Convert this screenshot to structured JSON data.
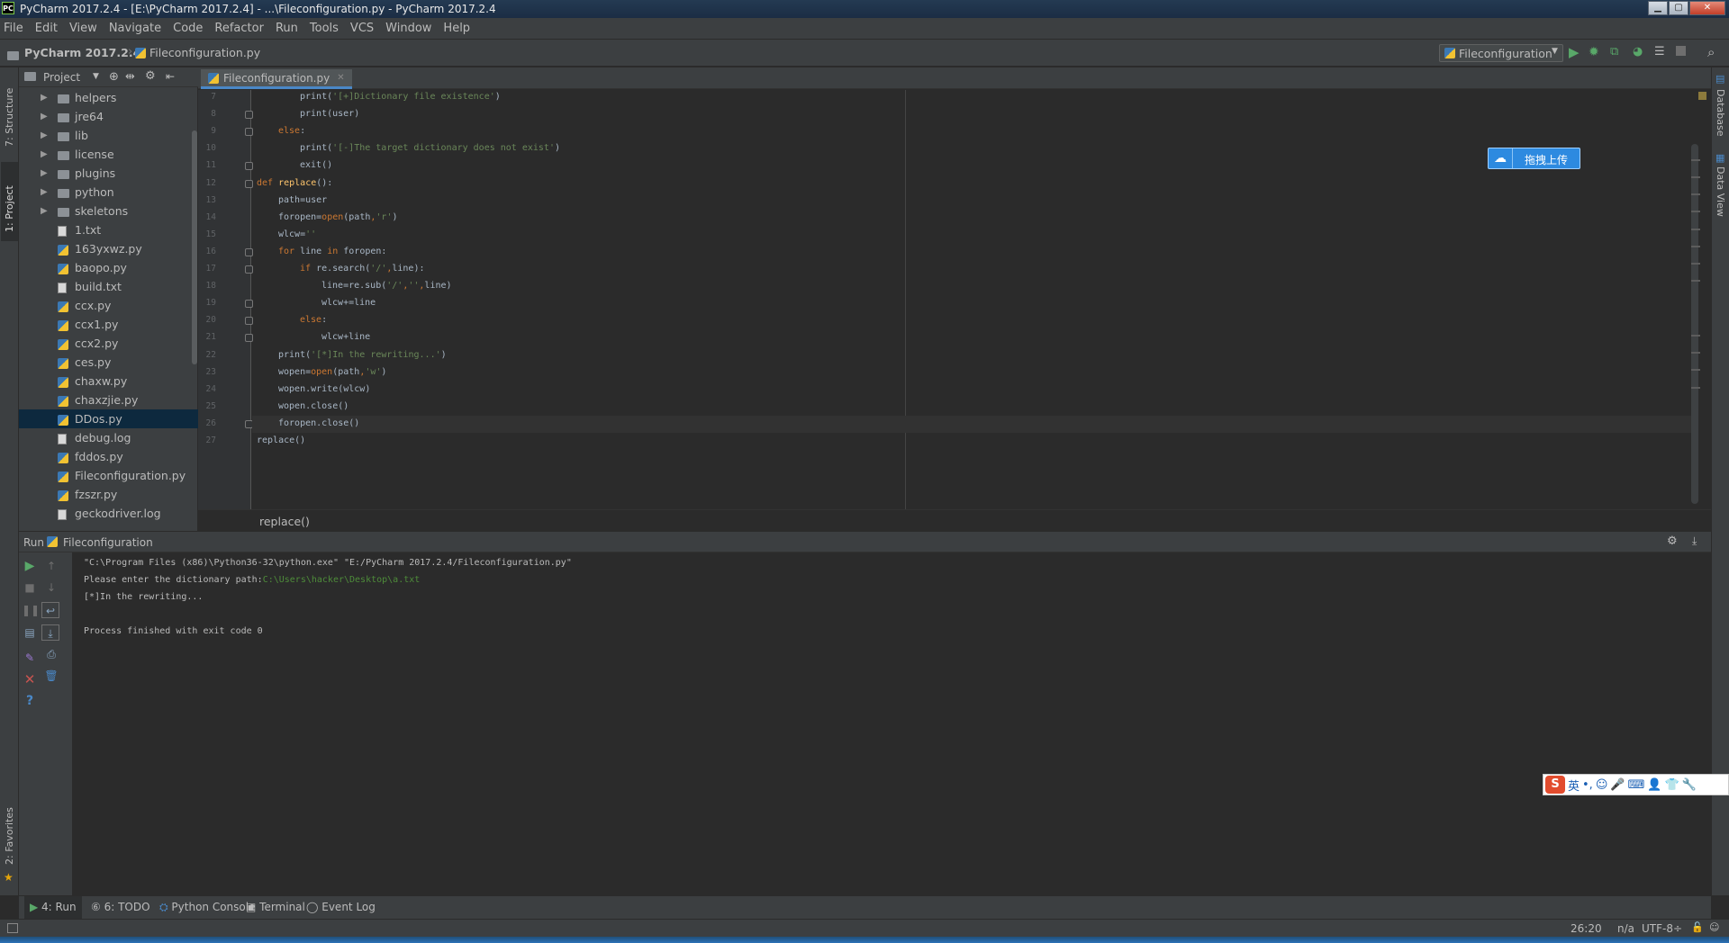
{
  "window": {
    "title": "PyCharm 2017.2.4 - [E:\\PyCharm 2017.2.4] - ...\\Fileconfiguration.py - PyCharm 2017.2.4",
    "app_icon": "PC",
    "controls": [
      "minimize",
      "maximize",
      "close"
    ]
  },
  "menu": [
    "File",
    "Edit",
    "View",
    "Navigate",
    "Code",
    "Refactor",
    "Run",
    "Tools",
    "VCS",
    "Window",
    "Help"
  ],
  "navbar": {
    "project": "PyCharm 2017.2.4",
    "file": "Fileconfiguration.py",
    "run_config": "Fileconfiguration"
  },
  "left_strip": {
    "structure": "7: Structure",
    "project": "1: Project",
    "favorites": "2: Favorites"
  },
  "right_strip": {
    "database": "Database",
    "data_view": "Data View"
  },
  "project_panel": {
    "title": "Project",
    "items": [
      {
        "label": "helpers",
        "type": "folder"
      },
      {
        "label": "jre64",
        "type": "folder"
      },
      {
        "label": "lib",
        "type": "folder"
      },
      {
        "label": "license",
        "type": "folder"
      },
      {
        "label": "plugins",
        "type": "folder"
      },
      {
        "label": "python",
        "type": "folder"
      },
      {
        "label": "skeletons",
        "type": "folder"
      },
      {
        "label": "1.txt",
        "type": "txt"
      },
      {
        "label": "163yxwz.py",
        "type": "py"
      },
      {
        "label": "baopo.py",
        "type": "py"
      },
      {
        "label": "build.txt",
        "type": "txt"
      },
      {
        "label": "ccx.py",
        "type": "py"
      },
      {
        "label": "ccx1.py",
        "type": "py"
      },
      {
        "label": "ccx2.py",
        "type": "py"
      },
      {
        "label": "ces.py",
        "type": "py"
      },
      {
        "label": "chaxw.py",
        "type": "py"
      },
      {
        "label": "chaxzjie.py",
        "type": "py"
      },
      {
        "label": "DDos.py",
        "type": "py",
        "selected": true
      },
      {
        "label": "debug.log",
        "type": "txt"
      },
      {
        "label": "fddos.py",
        "type": "py"
      },
      {
        "label": "Fileconfiguration.py",
        "type": "py"
      },
      {
        "label": "fzszr.py",
        "type": "py"
      },
      {
        "label": "geckodriver.log",
        "type": "txt"
      }
    ]
  },
  "editor": {
    "tab": "Fileconfiguration.py",
    "current_line": 26,
    "lines": [
      {
        "n": "7",
        "indent": 4,
        "parts": [
          [
            "",
            "print("
          ],
          [
            "str",
            "'[+]Dictionary file existence'"
          ],
          [
            "",
            ")"
          ]
        ]
      },
      {
        "n": "8",
        "indent": 4,
        "parts": [
          [
            "",
            "print(user)"
          ]
        ]
      },
      {
        "n": "9",
        "indent": 2,
        "parts": [
          [
            "kw",
            "else"
          ],
          [
            "",
            ":"
          ]
        ]
      },
      {
        "n": "10",
        "indent": 4,
        "parts": [
          [
            "",
            "print("
          ],
          [
            "str",
            "'[-]The target dictionary does not exist'"
          ],
          [
            "",
            ")"
          ]
        ]
      },
      {
        "n": "11",
        "indent": 4,
        "parts": [
          [
            "",
            "exit()"
          ]
        ]
      },
      {
        "n": "12",
        "indent": 0,
        "parts": [
          [
            "kw",
            "def "
          ],
          [
            "fn",
            "replace"
          ],
          [
            "",
            "():"
          ]
        ]
      },
      {
        "n": "13",
        "indent": 2,
        "parts": [
          [
            "",
            "path=user"
          ]
        ]
      },
      {
        "n": "14",
        "indent": 2,
        "parts": [
          [
            "",
            "foropen="
          ],
          [
            "kw",
            "open"
          ],
          [
            "",
            "(path"
          ],
          [
            "kw",
            ","
          ],
          [
            "str",
            "'r'"
          ],
          [
            "",
            ")"
          ]
        ]
      },
      {
        "n": "15",
        "indent": 2,
        "parts": [
          [
            "",
            "wlcw="
          ],
          [
            "str",
            "''"
          ]
        ]
      },
      {
        "n": "16",
        "indent": 2,
        "parts": [
          [
            "kw",
            "for "
          ],
          [
            "",
            "line "
          ],
          [
            "kw",
            "in "
          ],
          [
            "",
            "foropen:"
          ]
        ]
      },
      {
        "n": "17",
        "indent": 4,
        "parts": [
          [
            "kw",
            "if "
          ],
          [
            "",
            "re.search("
          ],
          [
            "str",
            "'/'"
          ],
          [
            "kw",
            ","
          ],
          [
            "",
            "line):"
          ]
        ]
      },
      {
        "n": "18",
        "indent": 6,
        "parts": [
          [
            "",
            "line=re.sub("
          ],
          [
            "str",
            "'/'"
          ],
          [
            "kw",
            ","
          ],
          [
            "str",
            "''"
          ],
          [
            "kw",
            ","
          ],
          [
            "",
            "line)"
          ]
        ]
      },
      {
        "n": "19",
        "indent": 6,
        "parts": [
          [
            "",
            "wlcw+=line"
          ]
        ]
      },
      {
        "n": "20",
        "indent": 4,
        "parts": [
          [
            "kw",
            "else"
          ],
          [
            "",
            ":"
          ]
        ]
      },
      {
        "n": "21",
        "indent": 6,
        "parts": [
          [
            "",
            "wlcw+line"
          ]
        ]
      },
      {
        "n": "22",
        "indent": 2,
        "parts": [
          [
            "",
            "print("
          ],
          [
            "str",
            "'[*]In the rewriting...'"
          ],
          [
            "",
            ")"
          ]
        ]
      },
      {
        "n": "23",
        "indent": 2,
        "parts": [
          [
            "",
            "wopen="
          ],
          [
            "kw",
            "open"
          ],
          [
            "",
            "(path"
          ],
          [
            "kw",
            ","
          ],
          [
            "str",
            "'w'"
          ],
          [
            "",
            ")"
          ]
        ]
      },
      {
        "n": "24",
        "indent": 2,
        "parts": [
          [
            "",
            "wopen.write(wlcw)"
          ]
        ]
      },
      {
        "n": "25",
        "indent": 2,
        "parts": [
          [
            "",
            "wopen.close()"
          ]
        ]
      },
      {
        "n": "26",
        "indent": 2,
        "parts": [
          [
            "",
            "foropen.close()"
          ]
        ]
      },
      {
        "n": "27",
        "indent": 0,
        "parts": [
          [
            "",
            "replace()"
          ]
        ]
      }
    ],
    "breadcrumb": "replace()"
  },
  "baidu_upload": {
    "label": "拖拽上传"
  },
  "run_panel": {
    "title": "Run",
    "config": "Fileconfiguration",
    "console": [
      {
        "text": "\"C:\\Program Files (x86)\\Python36-32\\python.exe\" \"E:/PyCharm 2017.2.4/Fileconfiguration.py\"",
        "input": ""
      },
      {
        "text": "Please enter the dictionary path:",
        "input": "C:\\Users\\hacker\\Desktop\\a.txt"
      },
      {
        "text": "[*]In the rewriting...",
        "input": ""
      },
      {
        "text": "",
        "input": ""
      },
      {
        "text": "Process finished with exit code 0",
        "input": ""
      }
    ]
  },
  "bottom_tabs": [
    {
      "label": "4: Run",
      "icon": "run-icon",
      "active": true
    },
    {
      "label": "6: TODO",
      "icon": "todo-icon"
    },
    {
      "label": "Python Console",
      "icon": "python-console-icon"
    },
    {
      "label": "Terminal",
      "icon": "terminal-icon"
    },
    {
      "label": "Event Log",
      "icon": "event-log-icon"
    }
  ],
  "status": {
    "position": "26:20",
    "line_sep": "n/a",
    "encoding": "UTF-8÷"
  },
  "ime": {
    "mode": "英"
  },
  "colors": {
    "keyword": "#cc7832",
    "string": "#6a8759",
    "function": "#ffc66d",
    "selection": "#0d293e",
    "accent": "#4a88c7"
  }
}
